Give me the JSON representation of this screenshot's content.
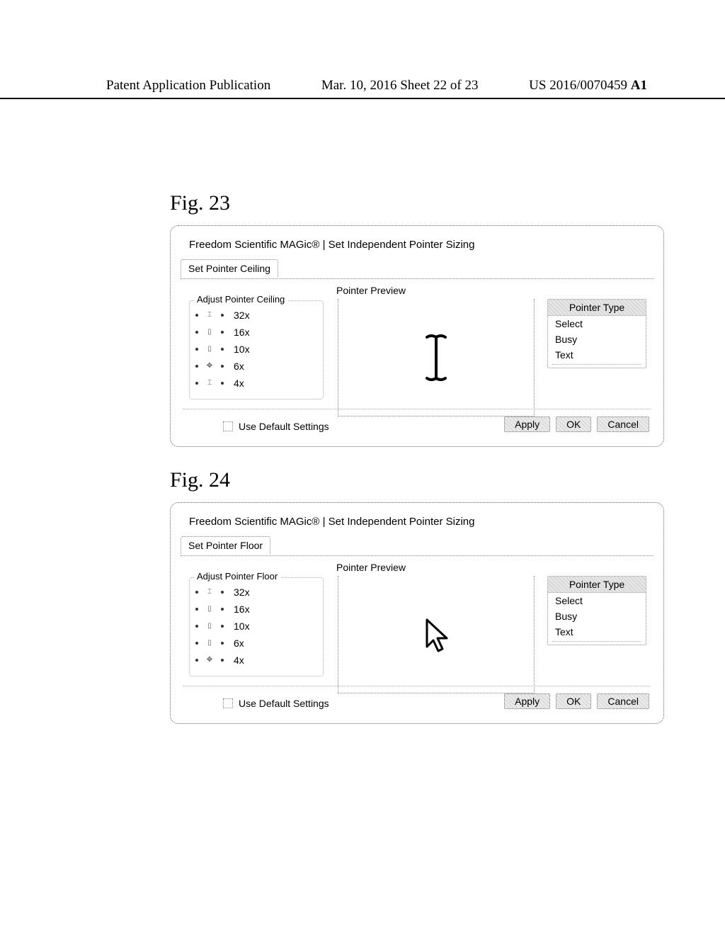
{
  "header": {
    "left": "Patent Application Publication",
    "mid": "Mar. 10, 2016  Sheet 22 of 23",
    "right_prefix": "US 2016/0070459 ",
    "right_suffix": "A1"
  },
  "fig23": {
    "label": "Fig. 23",
    "dialog_title": "Freedom Scientific MAGic®  |  Set Independent Pointer Sizing",
    "tab_label": "Set Pointer Ceiling",
    "preview_header": "Pointer Preview",
    "slider_legend": "Adjust Pointer Ceiling",
    "slider_values": [
      "32x",
      "16x",
      "10x",
      "6x",
      "4x"
    ],
    "selected_index": 3,
    "type_head": "Pointer Type",
    "type_items": [
      "Select",
      "Busy",
      "Text"
    ],
    "default_label": "Use Default Settings",
    "buttons": {
      "apply": "Apply",
      "ok": "OK",
      "cancel": "Cancel"
    },
    "preview_cursor": "text"
  },
  "fig24": {
    "label": "Fig. 24",
    "dialog_title": "Freedom Scientific MAGic®  |  Set Independent Pointer Sizing",
    "tab_label": "Set Pointer Floor",
    "preview_header": "Pointer Preview",
    "slider_legend": "Adjust Pointer Floor",
    "slider_values": [
      "32x",
      "16x",
      "10x",
      "6x",
      "4x"
    ],
    "selected_index": 4,
    "type_head": "Pointer Type",
    "type_items": [
      "Select",
      "Busy",
      "Text"
    ],
    "default_label": "Use Default Settings",
    "buttons": {
      "apply": "Apply",
      "ok": "OK",
      "cancel": "Cancel"
    },
    "preview_cursor": "arrow"
  }
}
